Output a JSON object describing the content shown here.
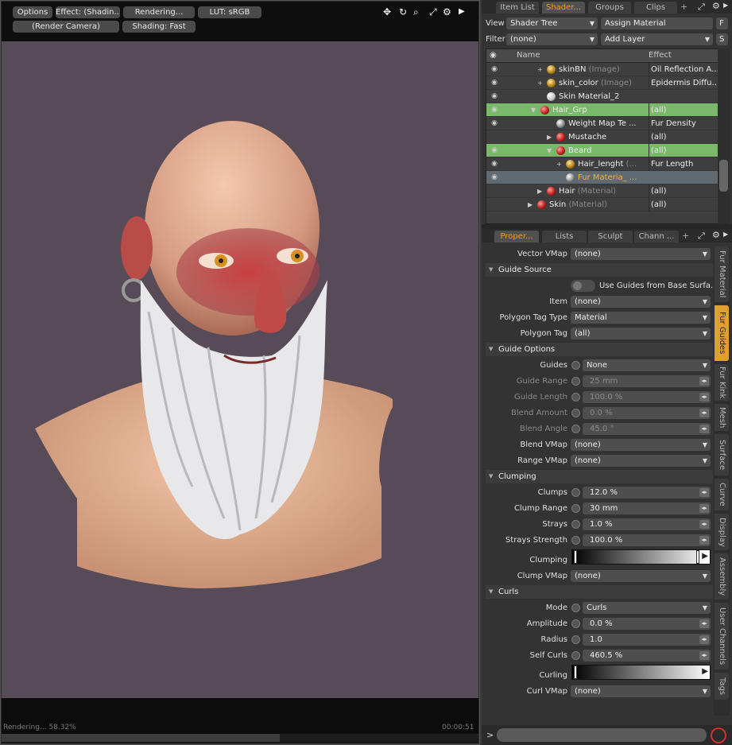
{
  "viewport": {
    "toolbar": {
      "options": "Options",
      "effect": "Effect: (Shadin...",
      "rendering": "Rendering...",
      "lut": "LUT: sRGB",
      "camera": "(Render Camera)",
      "shading": "Shading: Fast"
    },
    "icons": [
      "move-icon",
      "rotate-icon",
      "zoom-icon",
      "maximize-icon",
      "gear-icon",
      "play-icon"
    ],
    "status": {
      "left": "Rendering... 58.32%",
      "right": "00:00:51"
    },
    "progress": 58.32,
    "background_color": "#584b58"
  },
  "top_panel": {
    "tabs": [
      "Item List",
      "Shader...",
      "Groups",
      "Clips"
    ],
    "active_tab": 1,
    "view_label": "View",
    "view_value": "Shader Tree",
    "assign_button": "Assign Material",
    "f_button": "F",
    "filter_label": "Filter",
    "filter_value": "(none)",
    "add_layer": "Add Layer",
    "s_button": "S",
    "columns": {
      "name": "Name",
      "effect": "Effect"
    },
    "rows": [
      {
        "name": "skinBN",
        "suffix": " (Image)",
        "effect": "Oil Reflection A...",
        "eye": true,
        "ball": "img",
        "exp": "+",
        "indent": 76,
        "state": ""
      },
      {
        "name": "skin_color",
        "suffix": " (Image)",
        "effect": "Epidermis Diffu...",
        "eye": true,
        "ball": "img",
        "exp": "+",
        "indent": 76,
        "state": ""
      },
      {
        "name": "Skin Material_2",
        "suffix": "",
        "effect": "",
        "eye": true,
        "ball": "mat",
        "exp": "",
        "indent": 76,
        "state": ""
      },
      {
        "name": "Hair_Grp",
        "suffix": "",
        "effect": "(all)",
        "eye": true,
        "ball": "grp",
        "exp": "▼",
        "indent": 68,
        "state": "sel"
      },
      {
        "name": "Weight Map Te ...",
        "suffix": "",
        "effect": "Fur Density",
        "eye": true,
        "ball": "fur",
        "exp": "",
        "indent": 88,
        "state": ""
      },
      {
        "name": "Mustache",
        "suffix": "",
        "effect": "(all)",
        "eye": false,
        "ball": "grp",
        "exp": "▶",
        "indent": 88,
        "state": ""
      },
      {
        "name": "Beard",
        "suffix": "",
        "effect": "(all)",
        "eye": true,
        "ball": "grp",
        "exp": "▼",
        "indent": 88,
        "state": "sel"
      },
      {
        "name": "Hair_lenght",
        "suffix": " (...",
        "effect": "Fur Length",
        "eye": true,
        "ball": "img",
        "exp": "+",
        "indent": 100,
        "state": ""
      },
      {
        "name": "Fur Materia_ ...",
        "suffix": "",
        "effect": "",
        "eye": true,
        "ball": "fur",
        "exp": "",
        "indent": 100,
        "state": "cur"
      },
      {
        "name": "Hair",
        "suffix": " (Material)",
        "effect": "(all)",
        "eye": false,
        "ball": "grp",
        "exp": "▶",
        "indent": 76,
        "state": ""
      },
      {
        "name": "Skin",
        "suffix": " (Material)",
        "effect": "(all)",
        "eye": false,
        "ball": "grp",
        "exp": "▶",
        "indent": 64,
        "state": ""
      }
    ]
  },
  "bottom_panel": {
    "tabs": [
      "Proper...",
      "Lists",
      "Sculpt",
      "Chann ..."
    ],
    "active_tab": 0,
    "vector_vmap": {
      "label": "Vector VMap",
      "value": "(none)"
    },
    "guide_source": {
      "title": "Guide Source",
      "use_guides": "Use Guides from Base Surfa...",
      "item": {
        "label": "Item",
        "value": "(none)"
      },
      "polygon_tag_type": {
        "label": "Polygon Tag Type",
        "value": "Material"
      },
      "polygon_tag": {
        "label": "Polygon Tag",
        "value": "(all)"
      }
    },
    "guide_options": {
      "title": "Guide Options",
      "guides": {
        "label": "Guides",
        "value": "None"
      },
      "guide_range": {
        "label": "Guide Range",
        "value": "25 mm"
      },
      "guide_length": {
        "label": "Guide Length",
        "value": "100.0 %"
      },
      "blend_amount": {
        "label": "Blend Amount",
        "value": "0.0 %"
      },
      "blend_angle": {
        "label": "Blend Angle",
        "value": "45.0 °"
      },
      "blend_vmap": {
        "label": "Blend VMap",
        "value": "(none)"
      },
      "range_vmap": {
        "label": "Range VMap",
        "value": "(none)"
      }
    },
    "clumping": {
      "title": "Clumping",
      "clumps": {
        "label": "Clumps",
        "value": "12.0 %"
      },
      "clump_range": {
        "label": "Clump Range",
        "value": "30 mm"
      },
      "strays": {
        "label": "Strays",
        "value": "1.0 %"
      },
      "strays_strength": {
        "label": "Strays Strength",
        "value": "100.0 %"
      },
      "clumping_label": "Clumping",
      "clump_vmap": {
        "label": "Clump VMap",
        "value": "(none)"
      }
    },
    "curls": {
      "title": "Curls",
      "mode": {
        "label": "Mode",
        "value": "Curls"
      },
      "amplitude": {
        "label": "Amplitude",
        "value": "0.0 %"
      },
      "radius": {
        "label": "Radius",
        "value": "1.0"
      },
      "self_curls": {
        "label": "Self Curls",
        "value": "460.5 %"
      },
      "curling_label": "Curling",
      "curl_vmap": {
        "label": "Curl VMap",
        "value": "(none)"
      }
    },
    "side_tabs": [
      "Fur Material",
      "Fur Guides",
      "Fur Kink",
      "Mesh",
      "Surface",
      "Curve",
      "Display",
      "Assembly",
      "User Channels",
      "Tags"
    ],
    "active_side_tab": 1
  },
  "command": {
    "prompt": ">"
  }
}
